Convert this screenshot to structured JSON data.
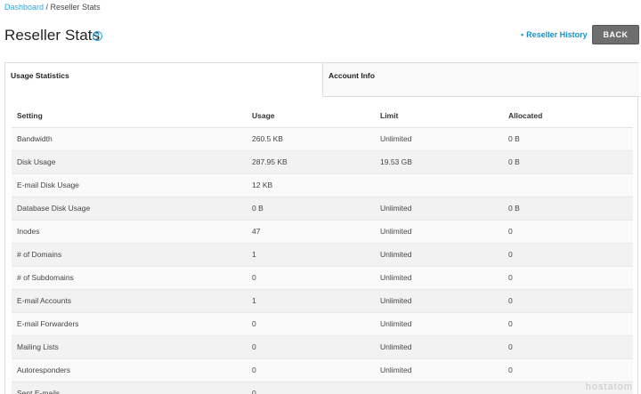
{
  "breadcrumb": {
    "root": "Dashboard",
    "separator": " / ",
    "current": "Reseller Stats"
  },
  "page_title": "Reseller Stats",
  "help_icon": "question-circle-icon",
  "header_link": {
    "bullet": "•",
    "label": "Reseller History"
  },
  "back_button": "BACK",
  "tabs": [
    {
      "label": "Usage Statistics",
      "active": true
    },
    {
      "label": "Account Info",
      "active": false
    }
  ],
  "table": {
    "headers": [
      "Setting",
      "Usage",
      "Limit",
      "Allocated"
    ],
    "rows": [
      {
        "setting": "Bandwidth",
        "usage": "260.5 KB",
        "limit": "Unlimited",
        "allocated": "0 B"
      },
      {
        "setting": "Disk Usage",
        "usage": "287.95 KB",
        "limit": "19.53 GB",
        "allocated": "0 B"
      },
      {
        "setting": "E-mail Disk Usage",
        "usage": "12 KB",
        "limit": "",
        "allocated": ""
      },
      {
        "setting": "Database Disk Usage",
        "usage": "0 B",
        "limit": "Unlimited",
        "allocated": "0 B"
      },
      {
        "setting": "Inodes",
        "usage": "47",
        "limit": "Unlimited",
        "allocated": "0"
      },
      {
        "setting": "# of Domains",
        "usage": "1",
        "limit": "Unlimited",
        "allocated": "0"
      },
      {
        "setting": "# of Subdomains",
        "usage": "0",
        "limit": "Unlimited",
        "allocated": "0"
      },
      {
        "setting": "E-mail Accounts",
        "usage": "1",
        "limit": "Unlimited",
        "allocated": "0"
      },
      {
        "setting": "E-mail Forwarders",
        "usage": "0",
        "limit": "Unlimited",
        "allocated": "0"
      },
      {
        "setting": "Mailing Lists",
        "usage": "0",
        "limit": "Unlimited",
        "allocated": "0"
      },
      {
        "setting": "Autoresponders",
        "usage": "0",
        "limit": "Unlimited",
        "allocated": "0"
      },
      {
        "setting": "Sent E-mails",
        "usage": "0",
        "limit": "",
        "allocated": ""
      }
    ]
  },
  "watermark": "hostatom",
  "colors": {
    "link": "#29a8e0",
    "button_bg": "#6e6e6e",
    "row_alt": "#f2f2f2"
  }
}
